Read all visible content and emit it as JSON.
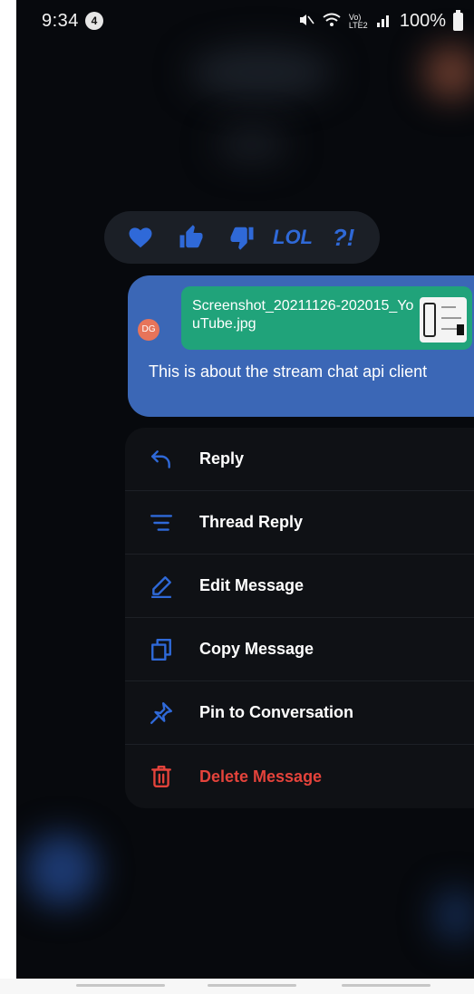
{
  "status_bar": {
    "time": "9:34",
    "notification_count": "4",
    "battery_percent": "100%",
    "network_label": "Vo) LTE2"
  },
  "reactions": [
    {
      "name": "heart-icon"
    },
    {
      "name": "thumbs-up-icon"
    },
    {
      "name": "thumbs-down-icon"
    },
    {
      "name": "lol-icon",
      "label": "LOL"
    },
    {
      "name": "wut-icon",
      "label": "?!"
    }
  ],
  "message": {
    "avatar_initials": "DG",
    "attachment_name": "Screenshot_20211126-202015_YouTube.jpg",
    "text": "This is about the stream chat api client"
  },
  "menu": {
    "items": [
      {
        "label": "Reply",
        "icon": "reply-icon"
      },
      {
        "label": "Thread Reply",
        "icon": "thread-reply-icon"
      },
      {
        "label": "Edit Message",
        "icon": "edit-icon"
      },
      {
        "label": "Copy Message",
        "icon": "copy-icon"
      },
      {
        "label": "Pin to Conversation",
        "icon": "pin-icon"
      },
      {
        "label": "Delete Message",
        "icon": "trash-icon"
      }
    ]
  },
  "colors": {
    "accent": "#2f69d8",
    "bubble": "#3b67b6",
    "attachment": "#20a37a",
    "danger": "#e4433b",
    "menu_bg": "#0f1115"
  }
}
